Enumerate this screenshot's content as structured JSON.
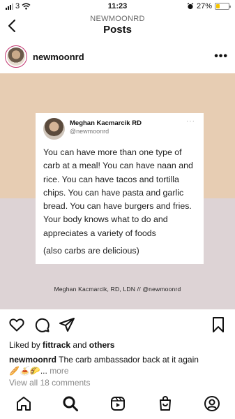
{
  "status_bar": {
    "carrier": "3",
    "time": "11:23",
    "battery": "27%",
    "battery_level": 0.27
  },
  "header": {
    "username": "NEWMOONRD",
    "title": "Posts"
  },
  "post": {
    "username": "newmoonrd",
    "image": {
      "tweet_name": "Meghan Kacmarcik RD",
      "tweet_handle": "@newmoonrd",
      "tweet_more": "···",
      "tweet_text": "You can have more than one type of carb at a meal! You can have naan and rice. You can have tacos and tortilla chips. You can have pasta and garlic bread. You can have burgers and fries. Your body knows what to do and appreciates a variety of foods",
      "tweet_paren": "(also carbs are delicious)",
      "credit": "Meghan Kacmarcik, RD, LDN // @newmoonrd"
    },
    "likes_prefix": "Liked by",
    "likes_user": "fittrack",
    "likes_and": "and",
    "likes_others": "others",
    "caption_user": "newmoonrd",
    "caption_text": "The carb ambassador back at it again",
    "caption_emoji": "🥖🍝🌮",
    "caption_ellipsis": "...",
    "caption_more": "more",
    "view_comments": "View all 18 comments"
  },
  "icons": {
    "status": [
      "signal-icon",
      "wifi-icon",
      "alarm-icon",
      "battery-icon"
    ],
    "header": [
      "back-icon",
      "more-icon"
    ],
    "actions": [
      "heart-icon",
      "comment-icon",
      "share-icon",
      "bookmark-icon"
    ],
    "nav": [
      "home-icon",
      "search-icon",
      "reels-icon",
      "shop-icon",
      "profile-icon"
    ]
  },
  "colors": {
    "image_top": "#e7cdb3",
    "image_bottom": "#ddd3d5",
    "battery": "#f5c400",
    "story_ring": "#c1356f"
  }
}
